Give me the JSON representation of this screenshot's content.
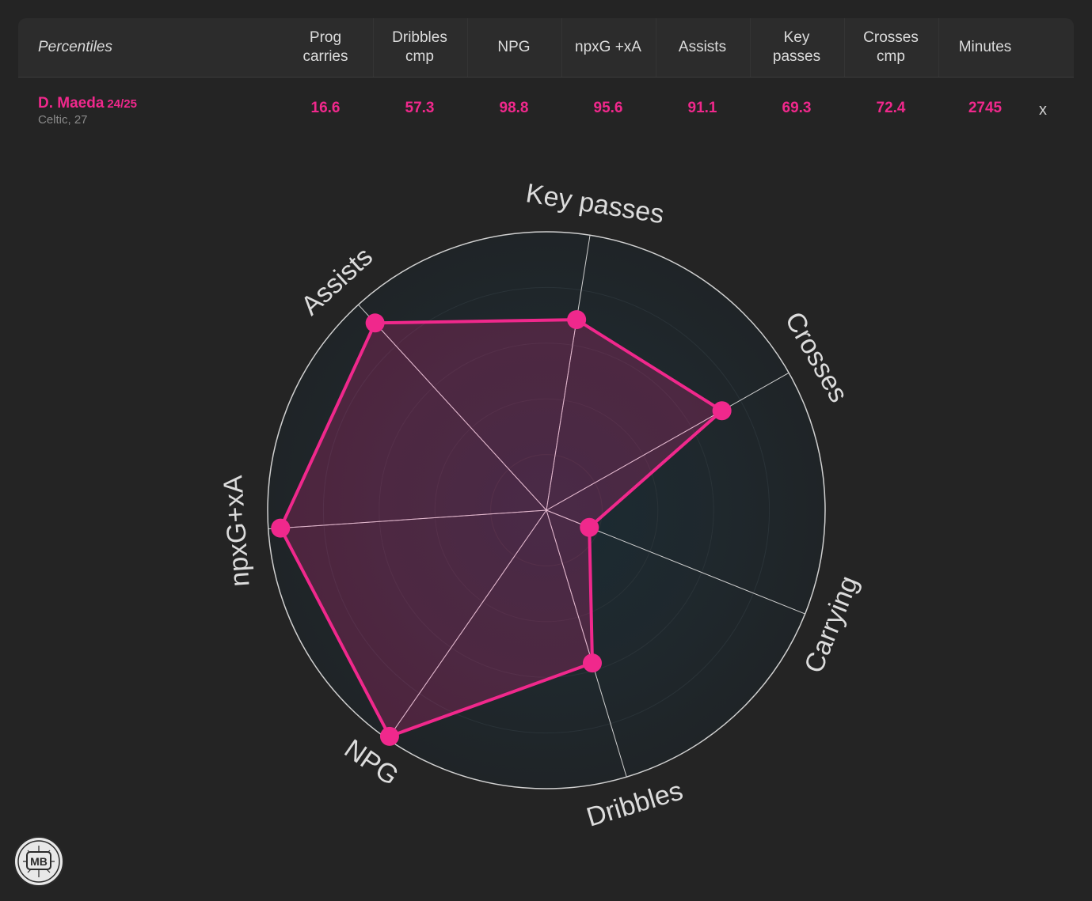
{
  "table": {
    "header_label": "Percentiles",
    "columns": [
      {
        "line1": "Prog",
        "line2": "carries"
      },
      {
        "line1": "Dribbles",
        "line2": "cmp"
      },
      {
        "line1": "NPG",
        "line2": ""
      },
      {
        "line1": "npxG +xA",
        "line2": ""
      },
      {
        "line1": "Assists",
        "line2": ""
      },
      {
        "line1": "Key",
        "line2": "passes"
      },
      {
        "line1": "Crosses",
        "line2": "cmp"
      },
      {
        "line1": "Minutes",
        "line2": ""
      }
    ],
    "row": {
      "name": "D. Maeda",
      "season": "24/25",
      "sub": "Celtic, 27",
      "values": [
        "16.6",
        "57.3",
        "98.8",
        "95.6",
        "91.1",
        "69.3",
        "72.4",
        "2745"
      ],
      "remove_label": "x"
    }
  },
  "colors": {
    "accent": "#f0288c",
    "background": "#242424",
    "header_bg": "#2c2c2c",
    "radar_bg": "#1f2427"
  },
  "chart_data": {
    "type": "radar",
    "axes": [
      "Key passes",
      "Crosses",
      "Carrying",
      "Dribbles",
      "NPG",
      "npxG+xA",
      "Assists"
    ],
    "series": [
      {
        "values": [
          69.3,
          72.4,
          16.6,
          57.3,
          98.8,
          95.6,
          91.1
        ]
      }
    ],
    "range": [
      0,
      100
    ]
  },
  "logo": {
    "text": "MB"
  }
}
